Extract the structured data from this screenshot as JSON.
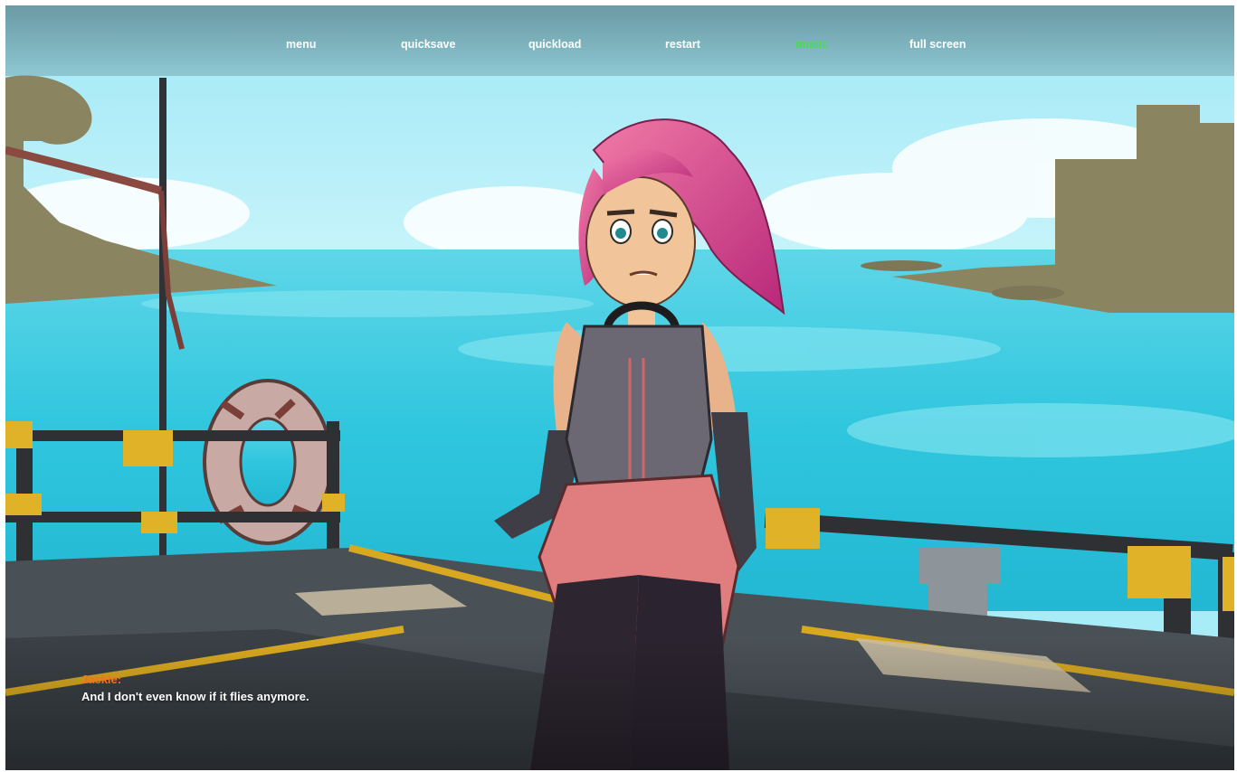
{
  "menu": {
    "items": [
      {
        "label": "menu"
      },
      {
        "label": "quicksave"
      },
      {
        "label": "quickload"
      },
      {
        "label": "restart"
      },
      {
        "label": "music",
        "active": true
      },
      {
        "label": "full screen"
      }
    ],
    "active_color": "#43e04a",
    "text_color": "#ffffff"
  },
  "dialogue": {
    "speaker": "Jackie:",
    "text": "And I don't even know if it flies anymore.",
    "speaker_color": "#ff6a1e"
  },
  "scene": {
    "description_icons": [
      "character-sprite",
      "life-ring",
      "railing",
      "dock",
      "ocean",
      "rocks"
    ]
  }
}
